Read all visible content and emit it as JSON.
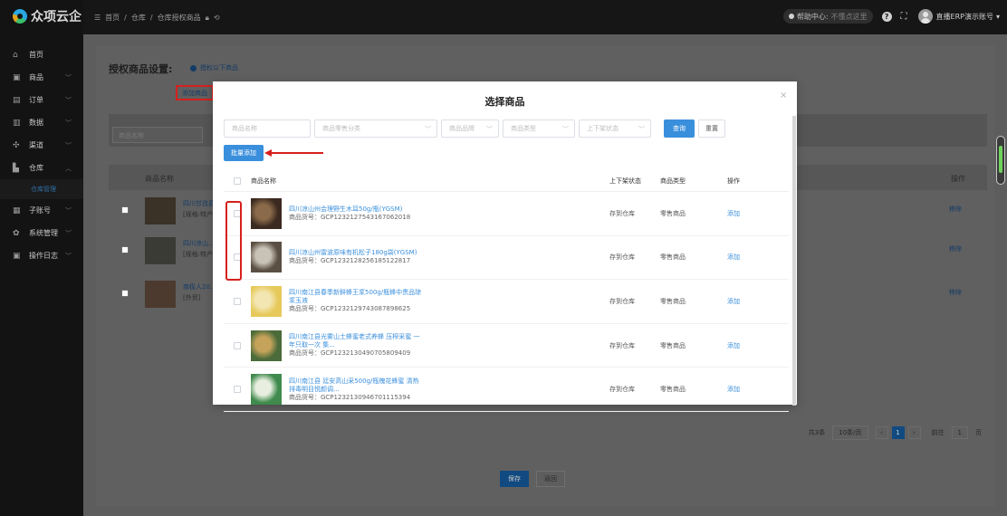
{
  "app": {
    "logo_text": "众项云企"
  },
  "topbar": {
    "breadcrumb": [
      "首页",
      "/",
      "仓库",
      "/",
      "仓库授权商品"
    ],
    "help_label": "帮助中心:",
    "help_hint": "不懂点这里",
    "account": "直播ERP演示账号"
  },
  "sidebar": {
    "items": [
      {
        "icon": "⌂",
        "label": "首页",
        "chev": ""
      },
      {
        "icon": "▣",
        "label": "商品",
        "chev": "﹀"
      },
      {
        "icon": "▤",
        "label": "订单",
        "chev": "﹀"
      },
      {
        "icon": "▥",
        "label": "数据",
        "chev": "﹀"
      },
      {
        "icon": "✣",
        "label": "渠道",
        "chev": "﹀"
      },
      {
        "icon": "▙",
        "label": "仓库",
        "chev": "︿"
      }
    ],
    "sub_item": "仓库管理",
    "items2": [
      {
        "icon": "▦",
        "label": "子账号",
        "chev": "﹀"
      },
      {
        "icon": "✿",
        "label": "系统管理",
        "chev": "﹀"
      },
      {
        "icon": "▣",
        "label": "操作日志",
        "chev": "﹀"
      }
    ]
  },
  "page": {
    "title": "授权商品设置:",
    "auth_link": "授权以下商品",
    "add_link": "添加商品",
    "search_placeholder": "商品名称",
    "col_name": "商品名称",
    "col_op": "操作",
    "rows": [
      {
        "title": "四川甘孜县黑…",
        "sub": "[规格:特产/干货…",
        "op": "移除",
        "thumb_color": "#3a3226"
      },
      {
        "title": "四川凉山…",
        "sub": "[规格:特产/干货…",
        "op": "移除",
        "thumb_color": "#3b3b35"
      },
      {
        "title": "南极人20…",
        "sub": "[外贸]",
        "op": "移除",
        "thumb_color": "#4c3a2f"
      }
    ],
    "pagination": {
      "total": "共3条",
      "page_size": "10条/页",
      "current": "1",
      "goto_label": "前往",
      "goto_value": "1",
      "page_unit": "页"
    },
    "save": "保存",
    "back": "返回"
  },
  "modal": {
    "title": "选择商品",
    "close": "×",
    "filters": {
      "name_placeholder": "商品名称",
      "category_placeholder": "商品零售分类",
      "brand_placeholder": "商品品牌",
      "type_placeholder": "商品类型",
      "status_placeholder": "上下架状态"
    },
    "query": "查询",
    "reset": "重置",
    "batch_add": "批量添加",
    "columns": {
      "name": "商品名称",
      "status": "上下架状态",
      "type": "商品类型",
      "op": "操作"
    },
    "rows": [
      {
        "name": "四川凉山州会理野生木耳50g/瓶(YGSM)",
        "code": "商品货号：GCP1232127543167062018",
        "status": "存到仓库",
        "type": "零售商品",
        "op": "添加",
        "img": "#3b2a20",
        "img2": "#8a6a4a"
      },
      {
        "name": "四川凉山州雷波原味有机松子180g袋(YGSM)",
        "code": "商品货号：GCP1232128256185122817",
        "status": "存到仓库",
        "type": "零售商品",
        "op": "添加",
        "img": "#5a4f43",
        "img2": "#c9c2b6"
      },
      {
        "name": "四川南江县春季新鲜蜂王浆500g/瓶蜂中贵品琼浆玉液",
        "code": "商品货号：GCP1232129743087898625",
        "status": "存到仓库",
        "type": "零售商品",
        "op": "添加",
        "img": "#e6c95a",
        "img2": "#f3e6b2"
      },
      {
        "name": "四川南江县光雾山土蜂蜜老式养蜂 压榨采蜜 一年只取一次 集...",
        "code": "商品货号：GCP1232130490705809409",
        "status": "存到仓库",
        "type": "零售商品",
        "op": "添加",
        "img": "#4b6b3a",
        "img2": "#c5a35a"
      },
      {
        "name": "四川南江县 廷安高山采500g/瓶槐花蜂蜜 清热排毒明目悦颜调...",
        "code": "商品货号：GCP1232130946701115394",
        "status": "存到仓库",
        "type": "零售商品",
        "op": "添加",
        "img": "#3f8a4c",
        "img2": "#e8efe0"
      }
    ]
  },
  "colors": {
    "accent": "#3a8fdc",
    "highlight": "#d6201d"
  }
}
